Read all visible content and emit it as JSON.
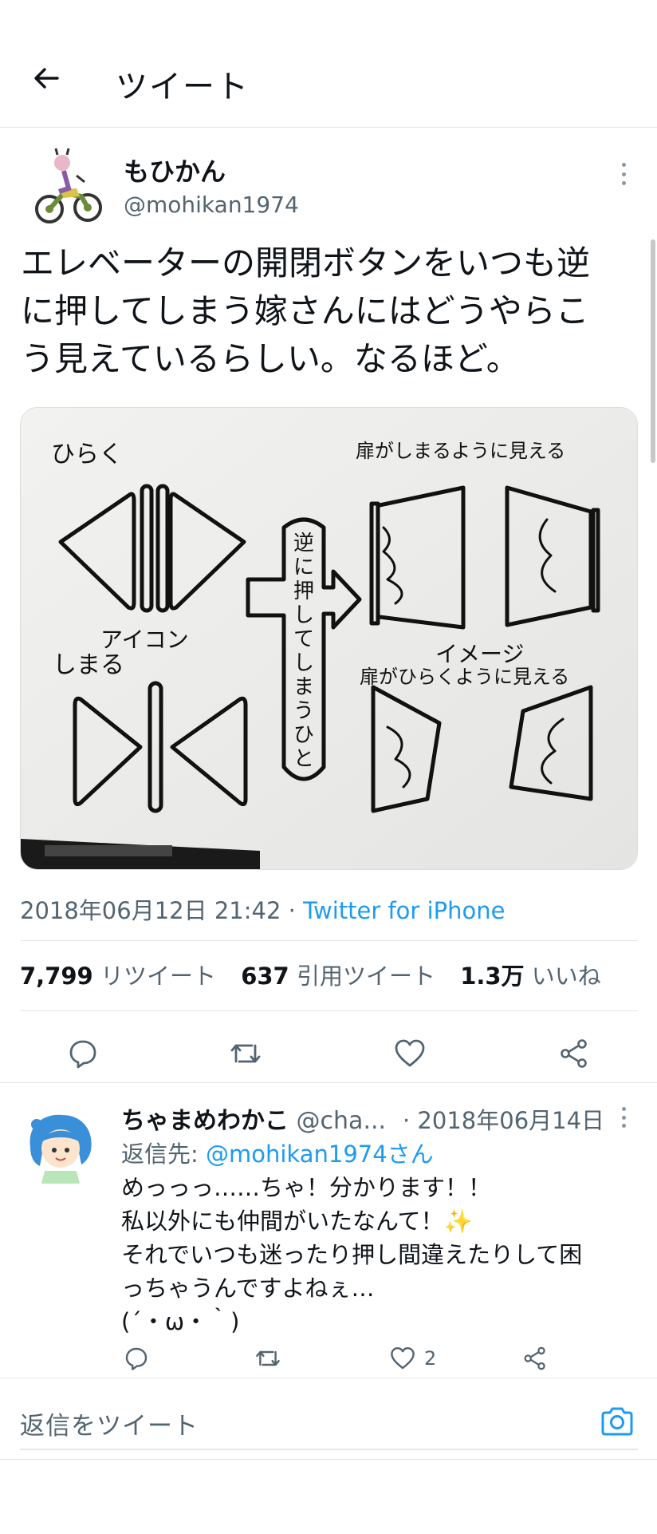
{
  "header": {
    "title": "ツイート"
  },
  "tweet": {
    "author_name": "もひかん",
    "author_handle": "@mohikan1974",
    "text_lines": [
      "エレベーターの開閉ボタンをいつも逆",
      "に押してしまう嫁さんにはどうやらこ",
      "う見えているらしい。なるほど。"
    ],
    "image_text": {
      "open": "ひらく",
      "close": "しまる",
      "icon": "アイコン",
      "reverse_lines": [
        "逆",
        "に",
        "押",
        "し",
        "て",
        "し",
        "ま",
        "う",
        "ひ",
        "と"
      ],
      "image_label": "イメージ",
      "door_close_caption": "扉がしまるように見える",
      "door_open_caption": "扉がひらくように見える"
    },
    "timestamp": "2018年06月12日 21:42",
    "separator": " · ",
    "source": "Twitter for iPhone",
    "stats": {
      "retweets_count": "7,799",
      "retweets_label": "リツイート",
      "quotes_count": "637",
      "quotes_label": "引用ツイート",
      "likes_count": "1.3万",
      "likes_label": "いいね"
    }
  },
  "reply": {
    "author_name": "ちゃまめわかこ",
    "author_handle": "@cha...",
    "date": "· 2018年06月14日",
    "reply_to_label": "返信先: ",
    "reply_to_handle": "@mohikan1974さん",
    "body_lines": [
      "めっっっ……ちゃ！分かります！！",
      "私以外にも仲間がいたなんて！✨",
      "それでいつも迷ったり押し間違えたりして困",
      "っちゃうんですよねぇ…",
      "(´・ω・｀)"
    ],
    "like_count": "2"
  },
  "compose": {
    "placeholder": "返信をツイート"
  },
  "colors": {
    "accent": "#1d9bf0",
    "text": "#0f1419",
    "muted": "#536471",
    "border": "#e6e6e6"
  },
  "icons": [
    "back-arrow-icon",
    "more-icon",
    "reply-icon",
    "retweet-icon",
    "like-icon",
    "share-icon",
    "camera-icon"
  ]
}
